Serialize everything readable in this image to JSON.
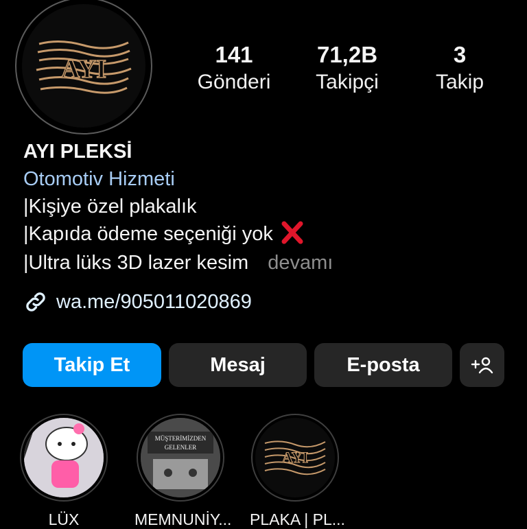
{
  "profile": {
    "logo_text": "AYI",
    "name": "AYI PLEKSİ",
    "category": "Otomotiv Hizmeti",
    "bio_lines": [
      "|Kişiye özel plakalık",
      "|Kapıda ödeme seçeniği yok",
      "|Ultra lüks 3D lazer kesim"
    ],
    "more_label": "devamı",
    "link": "wa.me/905011020869"
  },
  "stats": {
    "posts": {
      "value": "141",
      "label": "Gönderi"
    },
    "followers": {
      "value": "71,2B",
      "label": "Takipçi"
    },
    "following": {
      "value": "3",
      "label": "Takip"
    }
  },
  "actions": {
    "follow": "Takip Et",
    "message": "Mesaj",
    "email": "E-posta",
    "add_user_icon": "add-user-icon"
  },
  "highlights": [
    {
      "label": "LÜX",
      "icon": "hello-kitty-thumbnail"
    },
    {
      "label": "MEMNUNİY...",
      "icon": "customer-plate-thumbnail",
      "image_text": [
        "MÜŞTERİMİZDEN",
        "GELENLER"
      ]
    },
    {
      "label": "PLAKA | PL...",
      "icon": "logo-thumbnail",
      "image_text": [
        "AYI"
      ]
    }
  ],
  "colors": {
    "accent": "#0095f6",
    "category": "#a8cdf5",
    "button_bg": "#262626",
    "background": "#000000",
    "logo_gold": "#c79a6b"
  }
}
